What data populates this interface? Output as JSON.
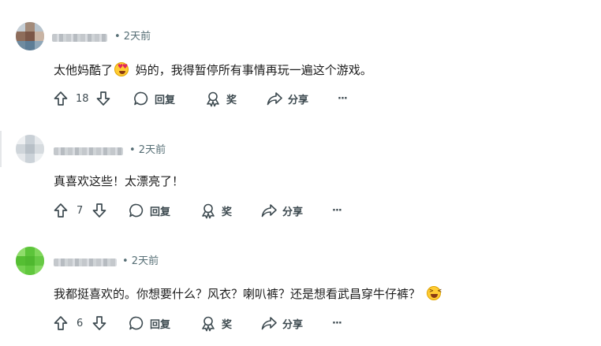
{
  "labels": {
    "reply": "回复",
    "award": "奖",
    "share": "分享",
    "more": "···"
  },
  "comments": [
    {
      "time": "• 2天前",
      "text_a": "太他妈酷了",
      "emoji_a": "heart-eyes",
      "text_b": " 妈的，我得暂停所有事情再玩一遍这个游戏。",
      "votes": "18"
    },
    {
      "time": "• 2天前",
      "text_a": "真喜欢这些！太漂亮了！",
      "votes": "7"
    },
    {
      "time": "• 2天前",
      "text_a": "我都挺喜欢的。你想要什么？风衣？喇叭裤？还是想看武昌穿牛仔裤？",
      "emoji_b": "laughing",
      "votes": "6"
    }
  ],
  "colors": {
    "meta": "#576f76",
    "text": "#1c1c1c",
    "action": "#3d4a50"
  }
}
